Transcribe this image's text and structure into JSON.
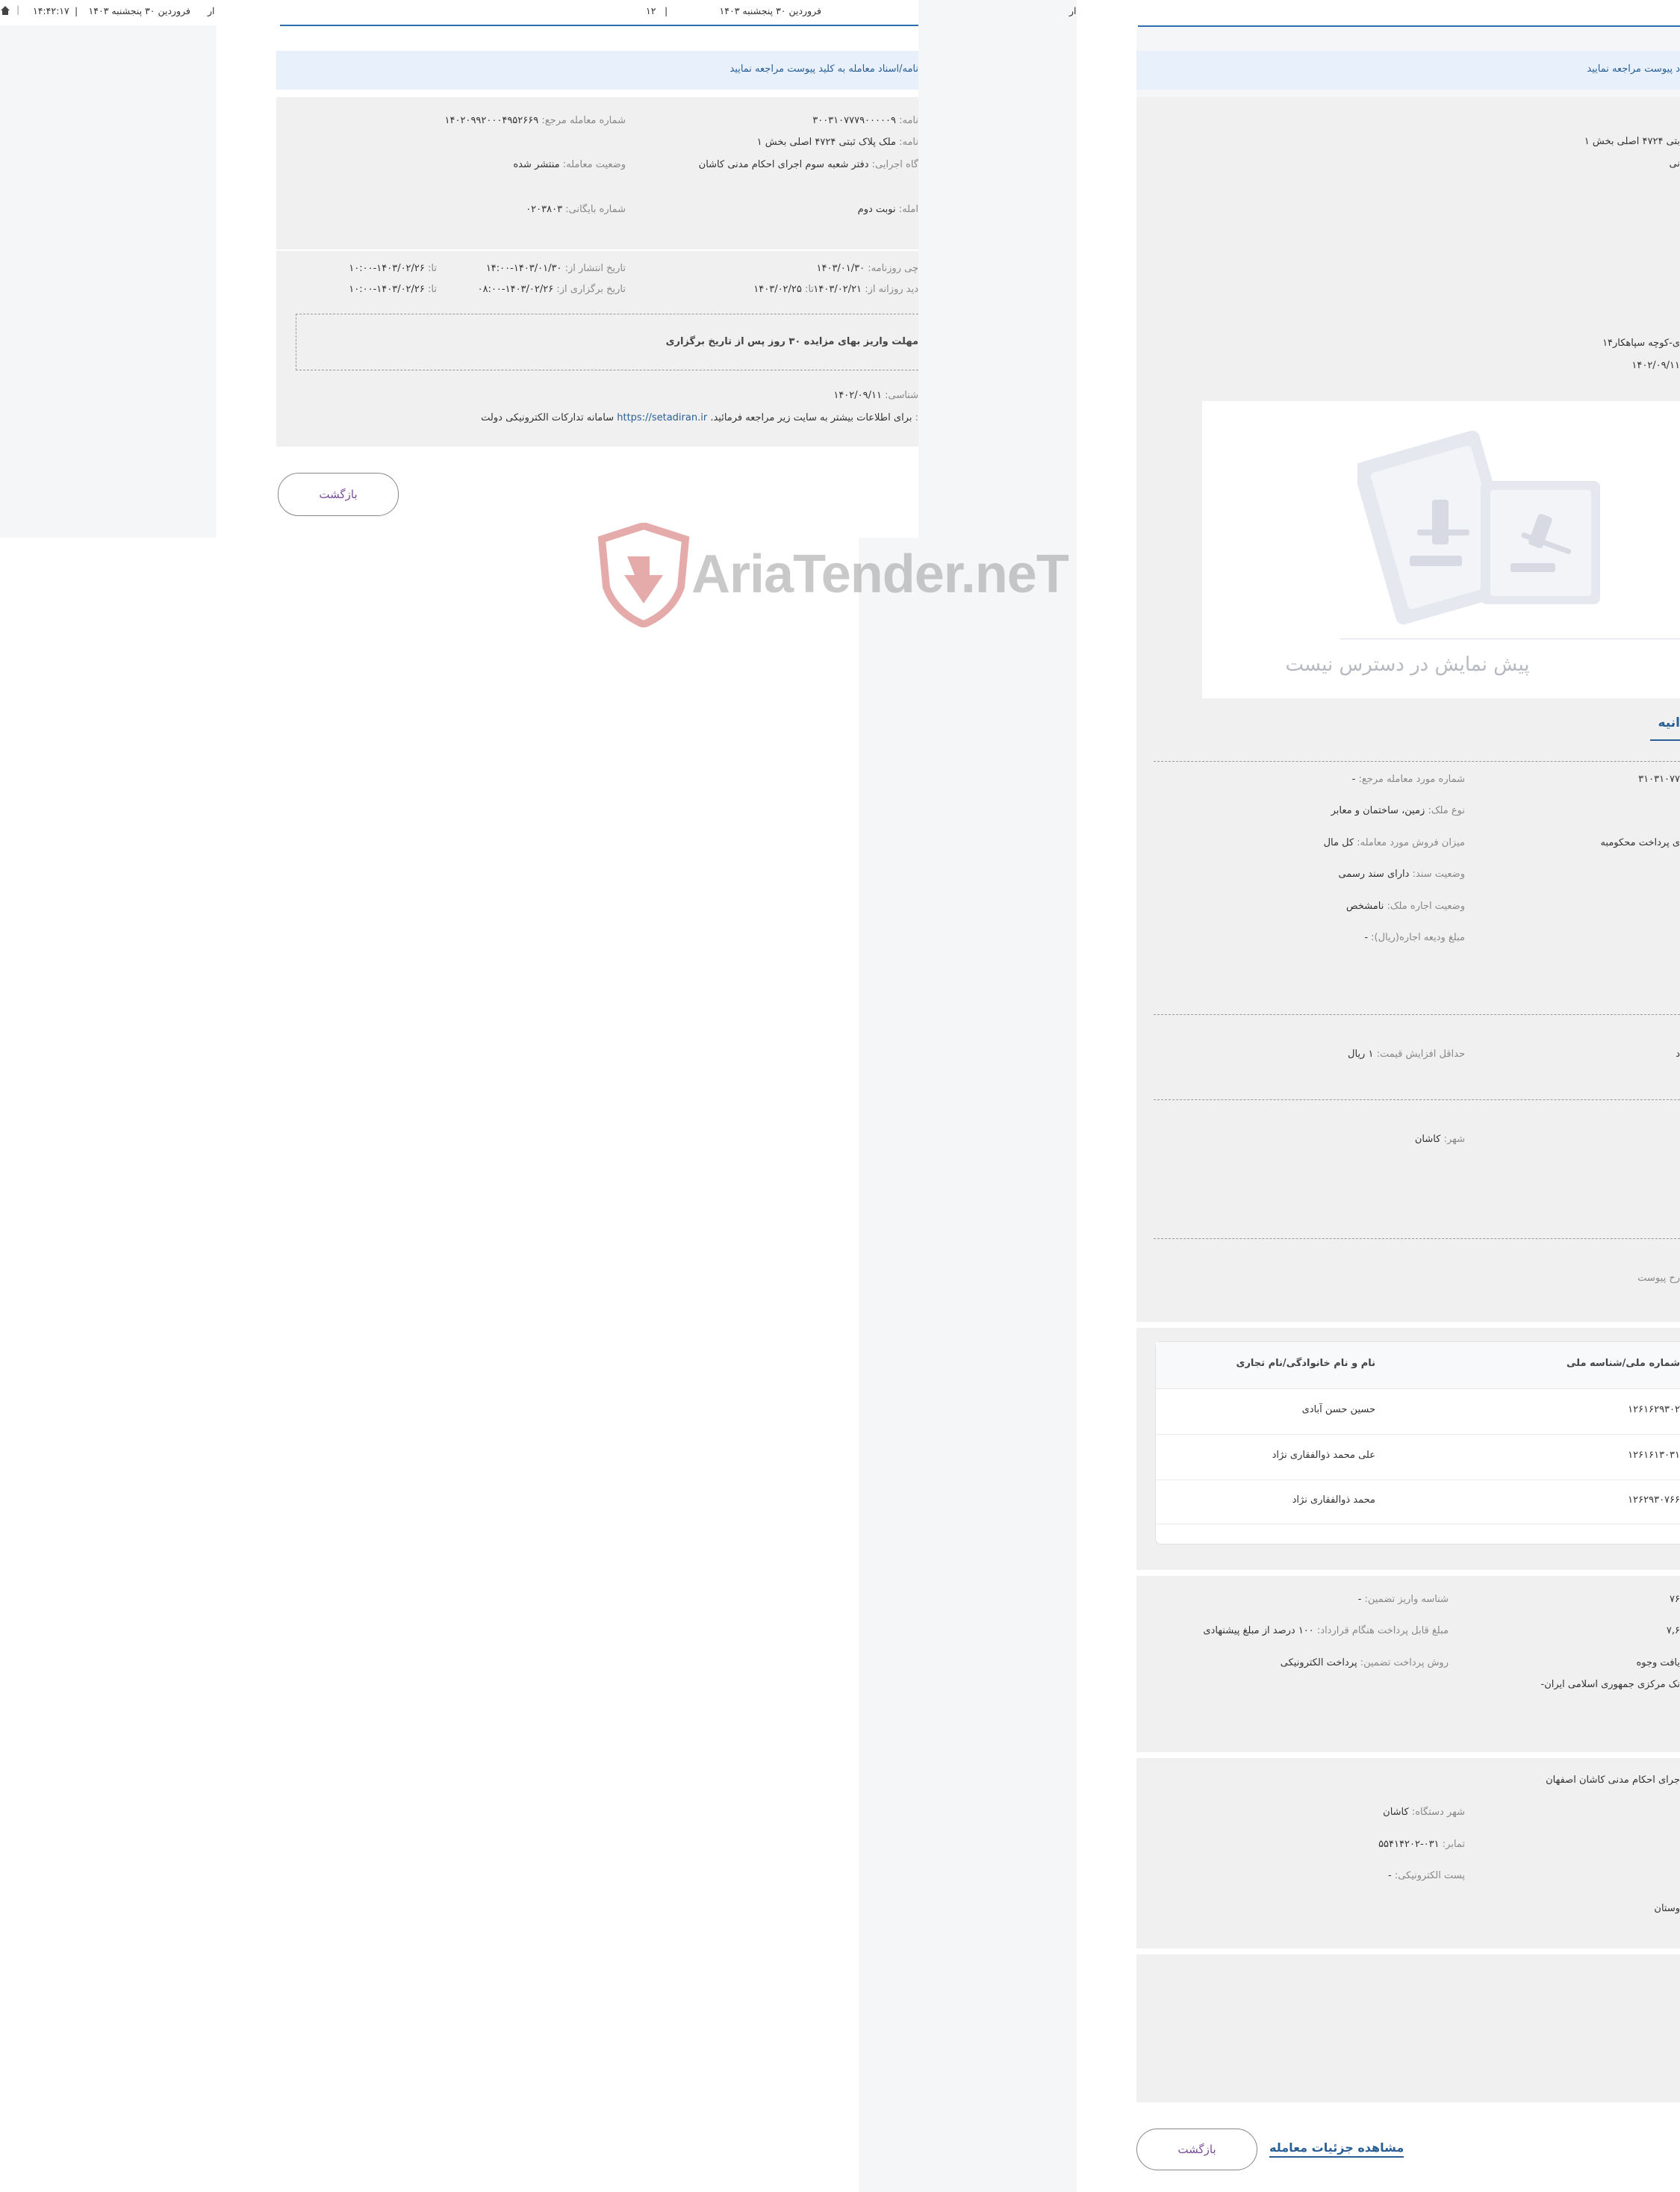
{
  "header": {
    "left_time": "۱۴:۴۲:۱۷",
    "left_date": "فروردین ۳۰ پنجشنبه ۱۴۰۳",
    "left_sep": "|",
    "left_extra": "ار",
    "mid_date": "فروردین ۳۰ پنجشنبه ۱۴۰۳",
    "mid_sep": "|",
    "mid_num": "۱۲",
    "mid_extra": "ار"
  },
  "left_panel": {
    "notice": "نامه/اسناد معامله به کلید پیوست مراجعه نمایید",
    "rows": [
      {
        "l1": "نامه:",
        "v1": "۳۰۰۳۱۰۷۷۷۹۰۰۰۰۰۹",
        "l2": "شماره معامله مرجع:",
        "v2": "۱۴۰۲۰۹۹۲۰۰۰۴۹۵۲۶۶۹"
      },
      {
        "l1": "نامه:",
        "v1": "ملک پلاک ثبتی ۴۷۲۴ اصلی بخش ۱",
        "l2": "",
        "v2": ""
      },
      {
        "l1": "گاه اجرایی:",
        "v1": "دفتر شعبه سوم اجرای احکام مدنی کاشان",
        "l2": "وضعیت معامله:",
        "v2": "منتشر شده"
      },
      {
        "l1": "امله:",
        "v1": "نوبت دوم",
        "l2": "شماره بایگانی:",
        "v2": "۰۲۰۳۸۰۳"
      }
    ],
    "dates": [
      {
        "l1": "چی روزنامه:",
        "v1": "۱۴۰۳/۰۱/۳۰",
        "l2": "تاریخ انتشار از:",
        "v2": "۱۴۰۳/۰۱/۳۰-۱۴:۰۰",
        "l3": "تا:",
        "v3": "۱۴۰۳/۰۲/۲۶-۱۰:۰۰"
      },
      {
        "l1": "دید روزانه از:",
        "v1": "۱۴۰۳/۰۲/۲۱",
        "l1b": "تا:",
        "v1b": "۱۴۰۳/۰۲/۲۵",
        "l2": "تاریخ برگزاری از:",
        "v2": "۱۴۰۳/۰۲/۲۶-۰۸:۰۰",
        "l3": "تا:",
        "v3": "۱۴۰۳/۰۲/۲۶-۱۰:۰۰"
      }
    ],
    "box_text": "مهلت واریز بهای مزایده ۳۰ روز پس از تاریخ برگزاری",
    "shenasi_label": "شناسی:",
    "shenasi_value": "۱۴۰۲/۰۹/۱۱",
    "info_label": ":",
    "info_text": "برای اطلاعات بیشتر به سایت زیر مراجعه فرمائید.",
    "info_link": "https://setadiran.ir",
    "info_tail": "سامانه تدارکات الکترونیکی دولت",
    "back_label": "بازگشت"
  },
  "watermark": "AriaTender.neT",
  "right_panel": {
    "notice": "د پیوست مراجعه نمایید",
    "top_line1": "بتی ۴۷۲۴ اصلی بخش ۱",
    "top_line2": "نی",
    "address": "ی-کوچه سپاهکار۱۴",
    "address_date": "۱۴۰۲/۰۹/۱۱",
    "preview_text": "پیش نمایش در دسترس نیست",
    "section_title": "انیه",
    "field_num_left": "۳۱۰۳۱۰۷۷",
    "field_reason": "ی پرداخت محکومبه",
    "fields": [
      {
        "label": "شماره مورد معامله مرجع:",
        "value": "-"
      },
      {
        "label": "نوع ملک:",
        "value": "زمین، ساختمان و معابر"
      },
      {
        "label": "میزان فروش مورد معامله:",
        "value": "کل مال"
      },
      {
        "label": "وضعیت سند:",
        "value": "دارای سند رسمی"
      },
      {
        "label": "وضعیت اجاره ملک:",
        "value": "نامشخص"
      },
      {
        "label": "مبلغ ودیعه اجاره(ریال):",
        "value": "-"
      }
    ],
    "min_inc_label": "حداقل افزایش قیمت:",
    "min_inc_value": "۱ ریال",
    "min_inc_right": "د",
    "city_label": "شهر:",
    "city_value": "کاشان",
    "attach_label": "رح پیوست",
    "table": {
      "headers": [
        "شماره ملی/شناسه ملی",
        "نام و نام خانوادگی/نام تجاری"
      ],
      "rows": [
        [
          "۱۲۶۱۶۲۹۳۰۲",
          "حسین حسن آبادی"
        ],
        [
          "۱۲۶۱۶۱۳۰۳۱",
          "علی محمد ذوالفقاری نژاد"
        ],
        [
          "۱۲۶۲۹۳۰۷۶۶",
          "محمد ذوالفقاری نژاد"
        ]
      ]
    },
    "pay": [
      {
        "label": "شناسه واریز تضمین:",
        "value": "-",
        "right": "۷۶"
      },
      {
        "label": "مبلغ قابل پرداخت هنگام قرارداد:",
        "value": "۱۰۰ درصد از مبلغ پیشنهادی",
        "right": "۷,۶"
      },
      {
        "label": "روش پرداخت تضمین:",
        "value": "پرداخت الکترونیکی",
        "right": "یافت وجوه"
      }
    ],
    "pay_bank": "نک مرکزی جمهوری اسلامی ایران-",
    "org_title": "جرای احکام مدنی کاشان اصفهان",
    "org": [
      {
        "label": "شهر دستگاه:",
        "value": "کاشان"
      },
      {
        "label": "تمابر:",
        "value": "۰۳۱-۵۵۴۱۴۲۰۲"
      },
      {
        "label": "پست الکترونیکی:",
        "value": "-"
      }
    ],
    "org_right": "وستان",
    "back_label": "بازگشت",
    "details_label": "مشاهده جزئیات معامله"
  }
}
